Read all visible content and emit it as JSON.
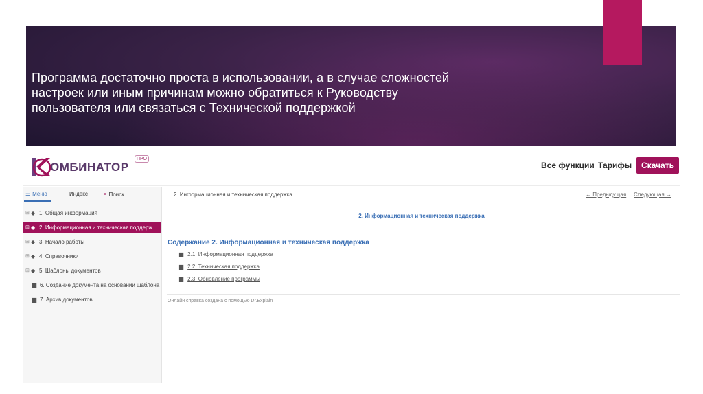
{
  "slide": {
    "title_lines": [
      "Программа достаточно проста в использовании, а в случае сложностей",
      "настроек или иным причинам можно обратиться к Руководству",
      "пользователя или связаться с Технической поддержкой"
    ],
    "accent_color": "#b5195f"
  },
  "site": {
    "logo_text": "ОМБИНАТОР",
    "logo_badge": "ПРО",
    "nav_all_functions": "Все функции",
    "nav_tariffs": "Тарифы",
    "download_label": "Скачать",
    "brand_color": "#a0125a"
  },
  "sidebar": {
    "tabs": {
      "menu": "Меню",
      "index": "Индекс",
      "search": "Поиск"
    },
    "items": [
      {
        "label": "1. Общая информация"
      },
      {
        "label": "2. Информационная и техническая поддерж"
      },
      {
        "label": "3. Начало работы"
      },
      {
        "label": "4. Справочники"
      },
      {
        "label": "5. Шаблоны документов"
      },
      {
        "label": "6. Создание документа на основании шаблона"
      },
      {
        "label": "7. Архив документов"
      }
    ]
  },
  "content": {
    "breadcrumb": "2. Информационная и техническая поддержка",
    "prev_label": "← Предыдущая",
    "next_label": "Следующая →",
    "heading": "2. Информационная и техническая поддержка",
    "contents_title": "Содержание 2. Информационная и техническая поддержка",
    "links": [
      "2.1. Информационная поддержка",
      "2.2. Техническая поддержка",
      "2.3. Обновление программы"
    ],
    "footer": "Онлайн справка создана с помощью Dr.Explain"
  }
}
